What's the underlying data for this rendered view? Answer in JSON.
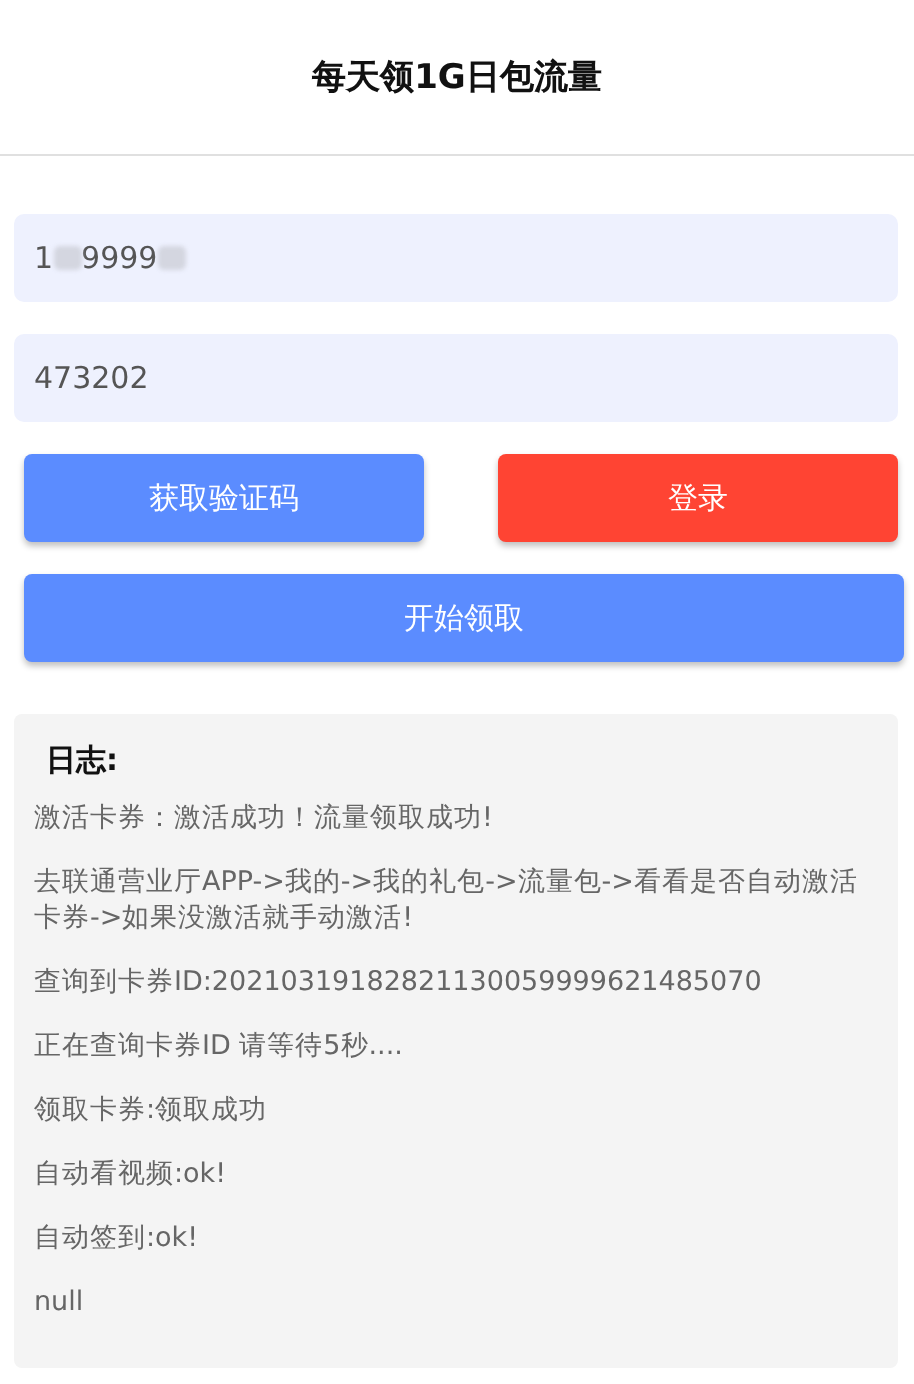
{
  "title": "每天领1G日包流量",
  "fields": [
    {
      "segments": [
        {
          "kind": "text",
          "text": "1"
        },
        {
          "kind": "blur"
        },
        {
          "kind": "text",
          "text": "9999"
        },
        {
          "kind": "blur"
        }
      ]
    },
    {
      "segments": [
        {
          "kind": "text",
          "text": "473202"
        }
      ]
    }
  ],
  "buttons": [
    {
      "label": "获取验证码",
      "color": "#5b8cff"
    },
    {
      "label": "登录",
      "color": "#ff4433"
    }
  ],
  "start_button": {
    "label": "开始领取"
  },
  "log": {
    "heading": "日志:",
    "lines": [
      "激活卡券：激活成功！流量领取成功!",
      "去联通营业厅APP->我的->我的礼包->流量包->看看是否自动激活卡券->如果没激活就手动激活!",
      "查询到卡券ID:20210319182821130059999621485070",
      "正在查询卡券ID 请等待5秒....",
      "领取卡券:领取成功",
      "自动看视频:ok!",
      "自动签到:ok!",
      "null"
    ]
  }
}
